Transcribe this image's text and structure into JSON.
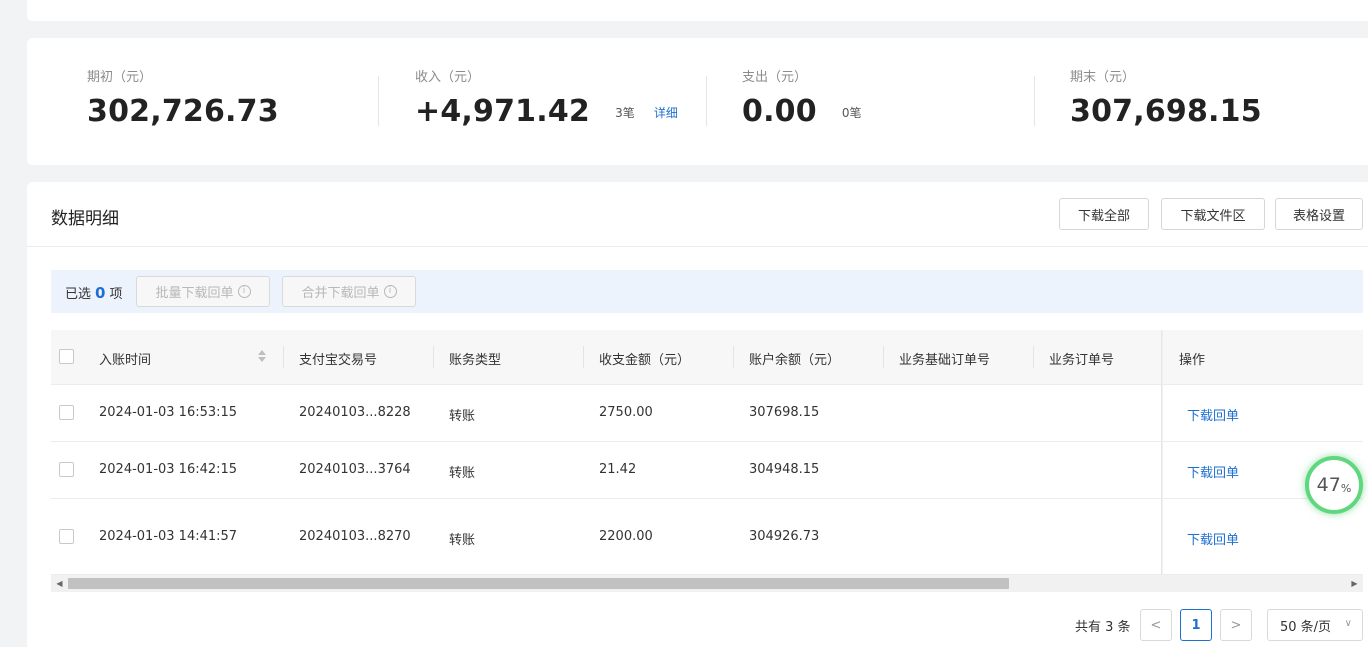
{
  "summary": {
    "opening": {
      "label": "期初（元）",
      "value": "302,726.73"
    },
    "income": {
      "label": "收入（元）",
      "value": "+4,971.42",
      "count": "3笔",
      "detail_link": "详细"
    },
    "expense": {
      "label": "支出（元）",
      "value": "0.00",
      "count": "0笔"
    },
    "closing": {
      "label": "期末（元）",
      "value": "307,698.15"
    }
  },
  "detail": {
    "title": "数据明细",
    "buttons": {
      "download_all": "下载全部",
      "download_files": "下载文件区",
      "table_settings": "表格设置"
    }
  },
  "selection": {
    "prefix": "已选",
    "count": "0",
    "suffix": "项",
    "batch_download": "批量下载回单",
    "merge_download": "合并下载回单"
  },
  "table": {
    "columns": [
      "入账时间",
      "支付宝交易号",
      "账务类型",
      "收支金额（元）",
      "账户余额（元）",
      "业务基础订单号",
      "业务订单号",
      "操作"
    ],
    "rows": [
      {
        "time": "2024-01-03 16:53:15",
        "trade_no": "20240103...8228",
        "type": "转账",
        "amount": "2750.00",
        "balance": "307698.15",
        "action": "下载回单"
      },
      {
        "time": "2024-01-03 16:42:15",
        "trade_no": "20240103...3764",
        "type": "转账",
        "amount": "21.42",
        "balance": "304948.15",
        "action": "下载回单"
      },
      {
        "time": "2024-01-03 14:41:57",
        "trade_no": "20240103...8270",
        "type": "转账",
        "amount": "2200.00",
        "balance": "304926.73",
        "action": "下载回单"
      }
    ]
  },
  "pagination": {
    "total": "共有 3 条",
    "current_page": "1",
    "prev": "<",
    "next": ">",
    "page_size": "50 条/页"
  },
  "progress_badge": {
    "value": "47",
    "unit": "%"
  },
  "colors": {
    "accent": "#1f6fd1",
    "progress": "#5ed77e"
  }
}
